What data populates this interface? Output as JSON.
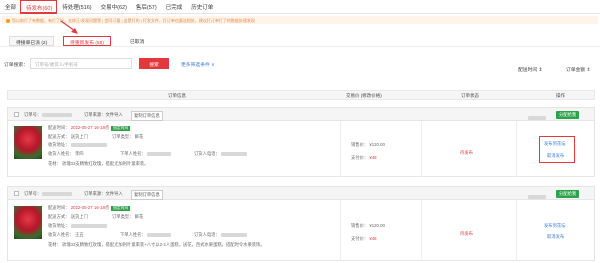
{
  "tabs": [
    {
      "label": "全部",
      "active": false
    },
    {
      "label": "待发布(60)",
      "active": true
    },
    {
      "label": "待处理(516)",
      "active": false
    },
    {
      "label": "交易中(62)",
      "active": false
    },
    {
      "label": "售后(57)",
      "active": false
    },
    {
      "label": "已完成",
      "active": false
    },
    {
      "label": "历史订单",
      "active": false
    }
  ],
  "notice": "您以前打了有数据，有打了好，去修正/发现问题等 | 会同订量 | 这是打的 | 打发文件，打订单也要这相处，建议打订单打了的数据处理发现",
  "subtabs": {
    "pending_receipt": "待接单已派 (2)",
    "pending_publish": "待重新发布 (58)",
    "cancelled": "已取消"
  },
  "search": {
    "label": "订单搜索：",
    "placeholder": "订单号/收货人/手机号",
    "button": "搜索",
    "more": "更多筛选条件 ∨",
    "delivery_time": "配送时间 ⇕",
    "order_amount": "订单金额 ⇕"
  },
  "columns": {
    "info": "订单信息",
    "amount": "交易价 (",
    "amount_link": "修改价格",
    "amount_end": ")",
    "status": "订单状态",
    "action": "操作"
  },
  "orders": [
    {
      "order_no_label": "订单号：",
      "source_label": "订单来源：文件导入",
      "copy_btn": "复制订单信息",
      "finish_btn": "分配给我",
      "delivery_time_label": "配送时间：",
      "delivery_time": "2022-05-27 16-18点",
      "time_tag": "指定时间",
      "delivery_method_label": "配送方式：",
      "delivery_method": "送货上门",
      "category_label": "订单类型：",
      "category": "鲜花",
      "address_label": "收货地址：",
      "receiver_label": "收货人姓名：",
      "receiver": "李四",
      "orderer_label": "下单人姓名：",
      "order_phone_label": "订货人电话：",
      "content_label": "花材：",
      "content": "玫瑰33支精致红玫瑰，搭配尤加利叶紧束装。",
      "price_label": "销售价：",
      "price": "¥120.00",
      "pay_label": "支付价：",
      "pay": "¥48",
      "status": "待发布",
      "action1": "发布到花坛",
      "action2": "取消发布"
    },
    {
      "order_no_label": "订单号：",
      "source_label": "订单来源：文件导入",
      "copy_btn": "复制订单信息",
      "finish_btn": "分配给我",
      "delivery_time_label": "配送时间：",
      "delivery_time": "2022-05-27 16-18点",
      "time_tag": "指定时间",
      "delivery_method_label": "配送方式：",
      "delivery_method": "送货上门",
      "category_label": "订单类型：",
      "category": "鲜花",
      "address_label": "收货地址：",
      "receiver_label": "收货人姓名：",
      "receiver": "王五",
      "orderer_label": "下单人姓名：",
      "order_phone_label": "订货人电话：",
      "content_label": "花材：",
      "content": "玫瑰33支精致红玫瑰，搭配尤加利叶紧束装+八寸以2-2人蛋糕，送花，西式水果蛋糕，搭配时令水果装饰。",
      "price_label": "销售价：",
      "price": "¥120.00",
      "pay_label": "支付价：",
      "pay": "¥48",
      "status": "待发布",
      "action1": "发布到花坛",
      "action2": "取消发布"
    }
  ],
  "colors": {
    "accent": "#e4393c",
    "link": "#3b7dd8",
    "success": "#2ea24a"
  }
}
